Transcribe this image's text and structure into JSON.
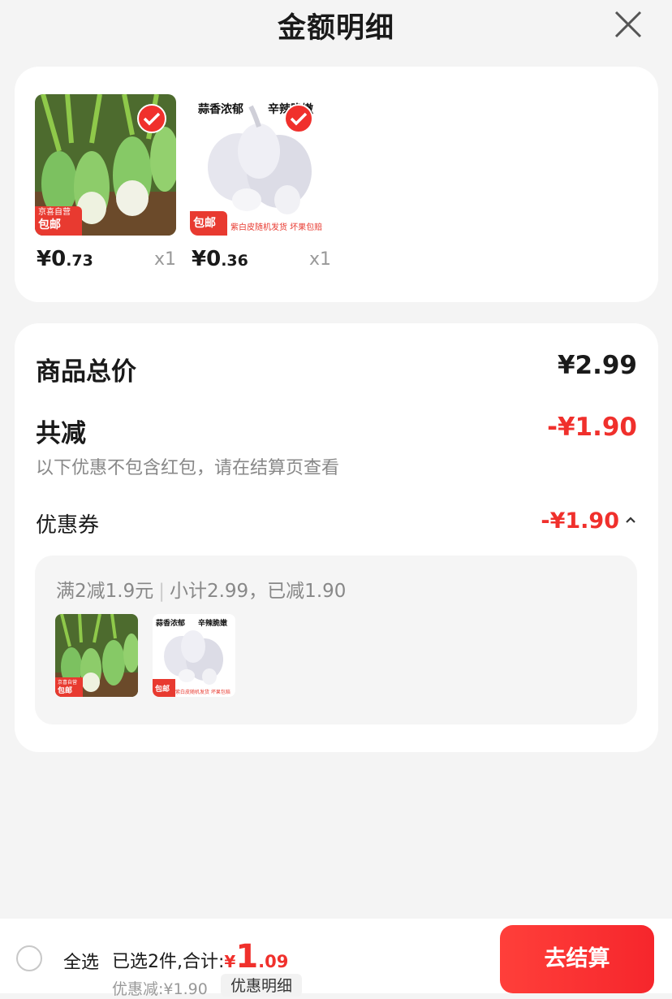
{
  "header": {
    "title": "金额明细"
  },
  "products": [
    {
      "name": "radish",
      "price_int": "¥0",
      "price_dec": ".73",
      "qty": "x1",
      "badge_top": "京喜自营",
      "badge_bottom": "包邮"
    },
    {
      "name": "garlic",
      "price_int": "¥0",
      "price_dec": ".36",
      "qty": "x1",
      "badge_top": "",
      "badge_bottom": "包邮",
      "tag_left": "蒜香浓郁",
      "tag_right": "辛辣脆嫩",
      "footer_text": "紫白皮随机发货 坏果包赔"
    }
  ],
  "summary": {
    "goods_total_label": "商品总价",
    "goods_total_value": "¥2.99",
    "reduction_label": "共减",
    "reduction_value": "-¥1.90",
    "note": "以下优惠不包含红包，请在结算页查看",
    "coupon_label": "优惠券",
    "coupon_value": "-¥1.90"
  },
  "coupon_detail": {
    "rule": "满2减1.9元",
    "sep": "|",
    "subtotal": "小计2.99，已减1.90",
    "garlic_tag_left": "蒜香浓郁",
    "garlic_tag_right": "辛辣脆嫩",
    "garlic_footer": "紫白皮随机发货 坏果包赔"
  },
  "footer": {
    "select_all": "全选",
    "selected_prefix": "已选2件,合计:",
    "total_symbol": "¥",
    "total_int": "1",
    "total_dec": ".09",
    "discount_text": "优惠减:¥1.90",
    "detail_button": "优惠明细",
    "checkout_button": "去结算"
  },
  "colors": {
    "accent": "#f0302c",
    "background": "#f4f4f4"
  }
}
